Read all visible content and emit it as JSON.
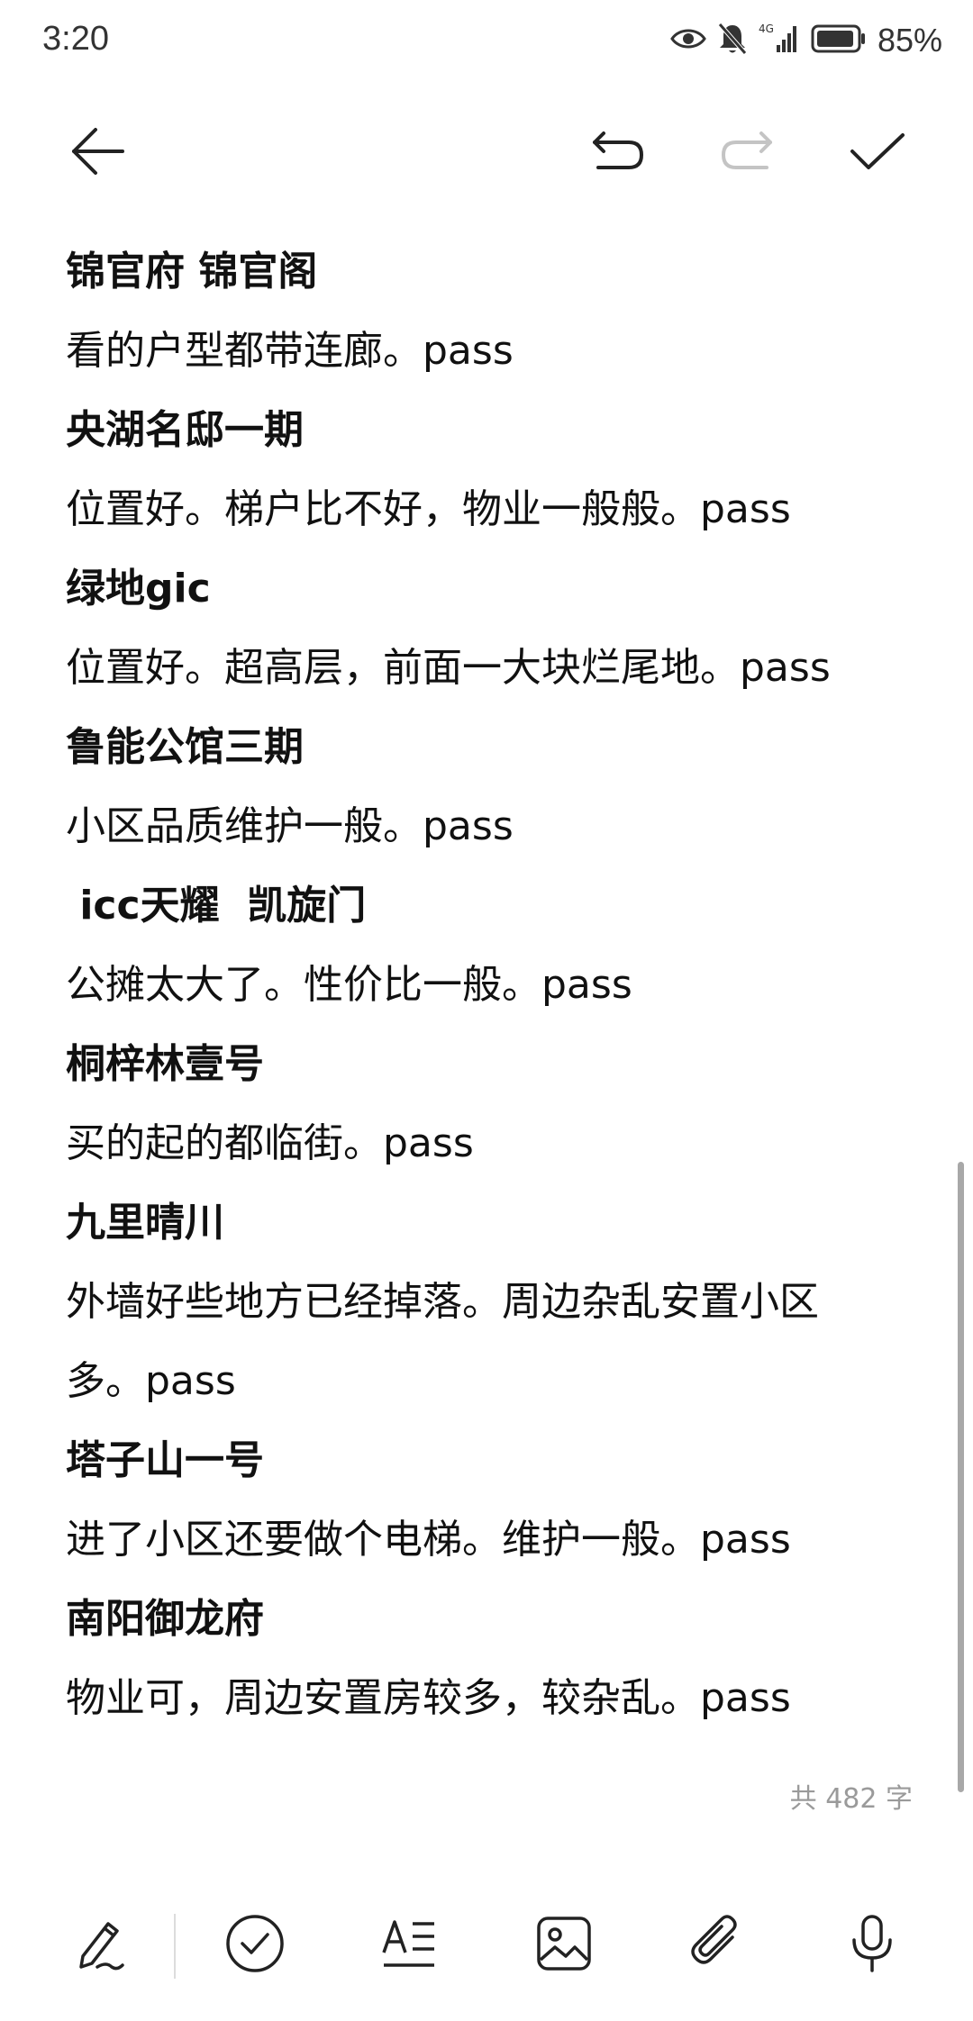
{
  "status_bar": {
    "time": "3:20",
    "battery_text": "85%",
    "icons": [
      "eye-icon",
      "bell-muted-icon",
      "signal-4g-icon",
      "battery-icon"
    ]
  },
  "toolbar": {
    "icons": [
      "back-arrow-icon",
      "undo-icon",
      "redo-icon",
      "check-icon"
    ]
  },
  "note": {
    "lines": [
      {
        "type": "heading",
        "text": "锦官府 锦官阁"
      },
      {
        "type": "body",
        "text": "看的户型都带连廊。pass"
      },
      {
        "type": "heading",
        "text": "央湖名邸一期"
      },
      {
        "type": "body",
        "text": "位置好。梯户比不好，物业一般般。pass"
      },
      {
        "type": "heading",
        "text": "绿地gic"
      },
      {
        "type": "body",
        "text": "位置好。超高层，前面一大块烂尾地。pass"
      },
      {
        "type": "heading",
        "text": "鲁能公馆三期"
      },
      {
        "type": "body",
        "text": "小区品质维护一般。pass"
      },
      {
        "type": "heading",
        "text": " icc天耀  凯旋门"
      },
      {
        "type": "body",
        "text": "公摊太大了。性价比一般。pass"
      },
      {
        "type": "heading",
        "text": "桐梓林壹号"
      },
      {
        "type": "body",
        "text": "买的起的都临街。pass"
      },
      {
        "type": "heading",
        "text": "九里晴川"
      },
      {
        "type": "body",
        "text": "外墙好些地方已经掉落。周边杂乱安置小区"
      },
      {
        "type": "body",
        "text": "多。pass"
      },
      {
        "type": "heading",
        "text": "塔子山一号"
      },
      {
        "type": "body",
        "text": "进了小区还要做个电梯。维护一般。pass"
      },
      {
        "type": "heading",
        "text": "南阳御龙府"
      },
      {
        "type": "body",
        "text": "物业可，周边安置房较多，较杂乱。pass"
      }
    ],
    "word_count": "共 482 字"
  },
  "bottom_bar": {
    "icons": [
      "pen-icon",
      "checklist-icon",
      "text-format-icon",
      "image-icon",
      "attachment-icon",
      "microphone-icon"
    ]
  },
  "colors": {
    "text": "#111111",
    "muted": "#9a9a9a",
    "disabled_icon": "#c4c4c4"
  }
}
